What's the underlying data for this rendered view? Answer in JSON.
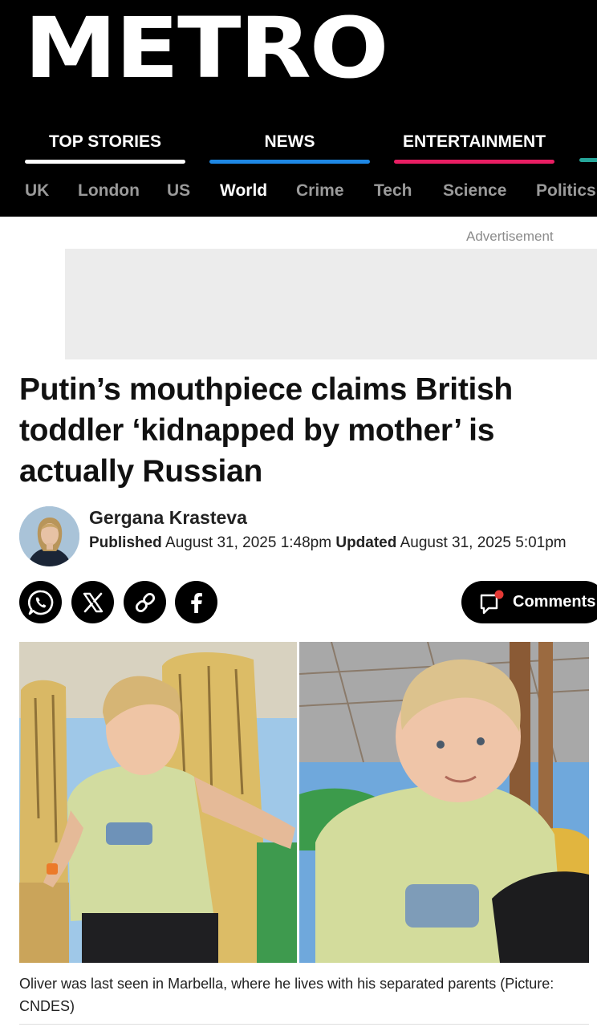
{
  "brand": {
    "logo_text": "METRO"
  },
  "section_tabs": [
    {
      "label": "TOP STORIES",
      "color": "#ffffff"
    },
    {
      "label": "NEWS",
      "color": "#1e88e5"
    },
    {
      "label": "ENTERTAINMENT",
      "color": "#e91e63"
    }
  ],
  "next_tab_color": "#26a69a",
  "sub_nav": {
    "items": [
      "UK",
      "London",
      "US",
      "World",
      "Crime",
      "Tech",
      "Science",
      "Politics"
    ],
    "active": "World"
  },
  "advertisement": {
    "label": "Advertisement"
  },
  "article": {
    "headline": "Putin’s mouthpiece claims British toddler ‘kidnapped by mother’ is actually Russian",
    "author": "Gergana Krasteva",
    "published_label": "Published",
    "published_date": "August 31, 2025 1:48pm",
    "updated_label": "Updated",
    "updated_date": "August 31, 2025 5:01pm",
    "caption": "Oliver was last seen in Marbella, where he lives with his separated parents (Picture: CNDES)"
  },
  "share": {
    "icons": [
      "whatsapp-icon",
      "x-icon",
      "link-icon",
      "facebook-icon"
    ],
    "comments_label": "Comments"
  }
}
